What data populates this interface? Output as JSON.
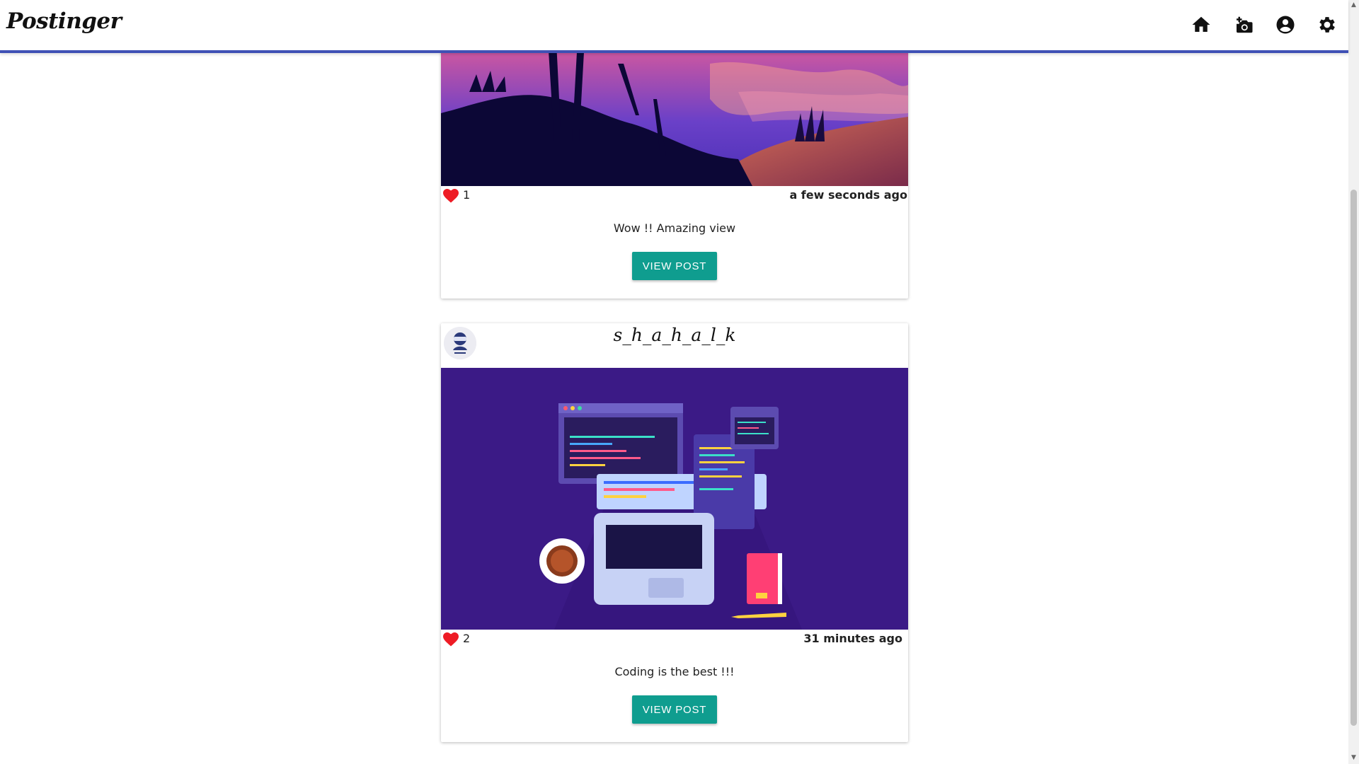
{
  "app": {
    "logo_text": "Postinger"
  },
  "nav": {
    "icons": [
      "home-icon",
      "add-photo-icon",
      "account-icon",
      "settings-icon"
    ]
  },
  "colors": {
    "accent_bar": "#3f51b5",
    "button_bg": "#0f9d8f",
    "heart": "#ee1c25"
  },
  "posts": [
    {
      "likes": "1",
      "time": "a few seconds ago",
      "caption": "Wow !! Amazing view",
      "button_label": "VIEW POST"
    },
    {
      "username": "s_h_a_h_a_l_k",
      "likes": "2",
      "time": "31 minutes ago",
      "caption": "Coding is the best !!!",
      "button_label": "VIEW POST"
    }
  ]
}
